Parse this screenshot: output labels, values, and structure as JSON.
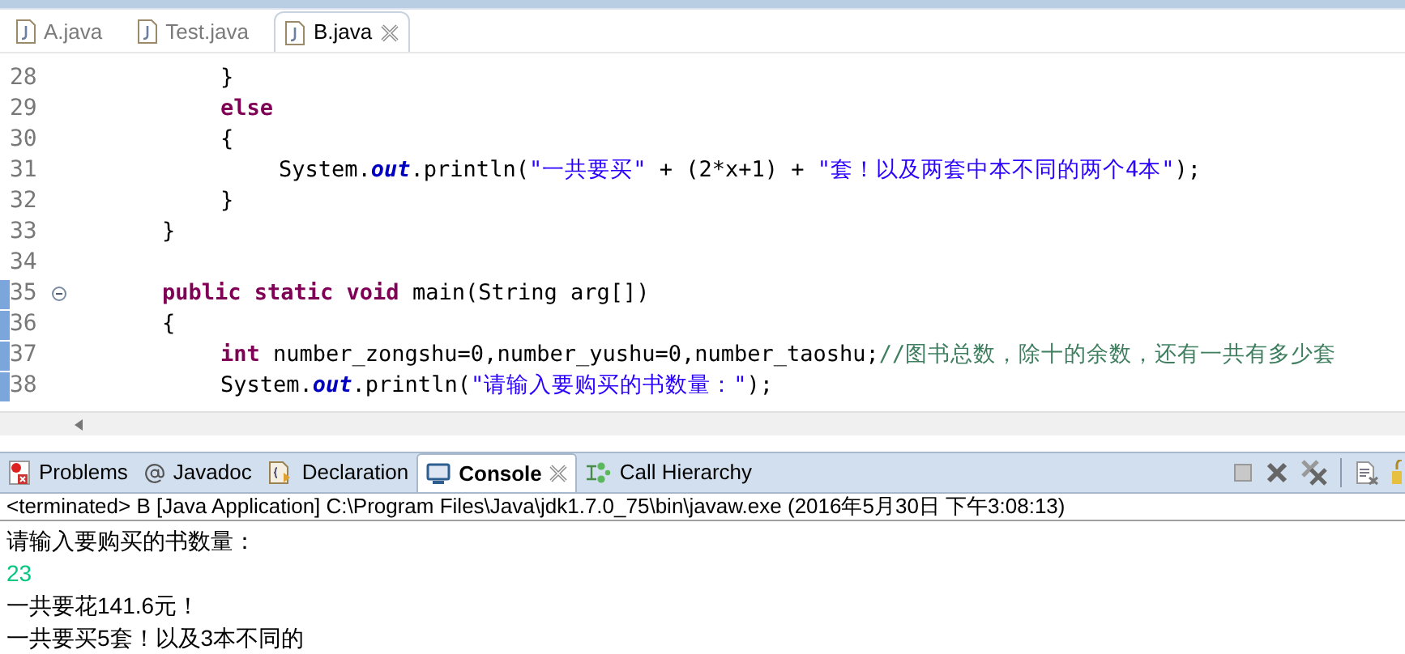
{
  "editor_tabs": [
    {
      "label": "A.java",
      "selected": false
    },
    {
      "label": "Test.java",
      "selected": false
    },
    {
      "label": "B.java",
      "selected": true
    }
  ],
  "code_lines": [
    {
      "number": "28",
      "fold_toggle": false,
      "changed": false,
      "tokens": [
        {
          "kind": "plain",
          "text": "        }"
        }
      ]
    },
    {
      "number": "29",
      "fold_toggle": false,
      "changed": false,
      "tokens": [
        {
          "kind": "keyword",
          "text": "        else"
        }
      ]
    },
    {
      "number": "30",
      "fold_toggle": false,
      "changed": false,
      "tokens": [
        {
          "kind": "plain",
          "text": "        {"
        }
      ]
    },
    {
      "number": "31",
      "fold_toggle": false,
      "changed": false,
      "tokens": [
        {
          "kind": "plain",
          "text": "            System."
        },
        {
          "kind": "field",
          "text": "out"
        },
        {
          "kind": "plain",
          "text": ".println("
        },
        {
          "kind": "string",
          "text": "\"一共要买\""
        },
        {
          "kind": "plain",
          "text": " + (2*x+1) + "
        },
        {
          "kind": "string",
          "text": "\"套！以及两套中本不同的两个4本\""
        },
        {
          "kind": "plain",
          "text": ");"
        }
      ]
    },
    {
      "number": "32",
      "fold_toggle": false,
      "changed": false,
      "tokens": [
        {
          "kind": "plain",
          "text": "        }"
        }
      ]
    },
    {
      "number": "33",
      "fold_toggle": false,
      "changed": false,
      "tokens": [
        {
          "kind": "plain",
          "text": "    }"
        }
      ]
    },
    {
      "number": "34",
      "fold_toggle": false,
      "changed": false
    },
    {
      "number": "35",
      "fold_toggle": true,
      "changed": true,
      "tokens": [
        {
          "kind": "keyword",
          "text": "    public static void"
        },
        {
          "kind": "plain",
          "text": " main(String arg[])"
        }
      ]
    },
    {
      "number": "36",
      "fold_toggle": false,
      "changed": true,
      "tokens": [
        {
          "kind": "plain",
          "text": "    {"
        }
      ]
    },
    {
      "number": "37",
      "fold_toggle": false,
      "changed": true,
      "tokens": [
        {
          "kind": "keyword",
          "text": "        int"
        },
        {
          "kind": "plain",
          "text": " number_zongshu=0,number_yushu=0,number_taoshu;"
        },
        {
          "kind": "comment",
          "text": "//图书总数，除十的余数，还有一共有多少套"
        }
      ]
    },
    {
      "number": "38",
      "fold_toggle": false,
      "changed": true,
      "tokens": [
        {
          "kind": "plain",
          "text": "        System."
        },
        {
          "kind": "field",
          "text": "out"
        },
        {
          "kind": "plain",
          "text": ".println("
        },
        {
          "kind": "string",
          "text": "\"请输入要购买的书数量：\""
        },
        {
          "kind": "plain",
          "text": ");"
        }
      ]
    }
  ],
  "view_tabs": [
    {
      "label": "Problems",
      "kind": "problems",
      "selected": false
    },
    {
      "label": "Javadoc",
      "kind": "javadoc",
      "selected": false
    },
    {
      "label": "Declaration",
      "kind": "declaration",
      "selected": false
    },
    {
      "label": "Console",
      "kind": "console",
      "selected": true
    },
    {
      "label": "Call Hierarchy",
      "kind": "hierarchy",
      "selected": false
    }
  ],
  "console": {
    "header": "<terminated> B [Java Application] C:\\Program Files\\Java\\jdk1.7.0_75\\bin\\javaw.exe (2016年5月30日 下午3:08:13)",
    "lines": [
      {
        "kind": "output",
        "text": "请输入要购买的书数量："
      },
      {
        "kind": "input",
        "text": "23"
      },
      {
        "kind": "output",
        "text": "一共要花141.6元！"
      },
      {
        "kind": "output",
        "text": "一共要买5套！以及3本不同的"
      }
    ]
  }
}
